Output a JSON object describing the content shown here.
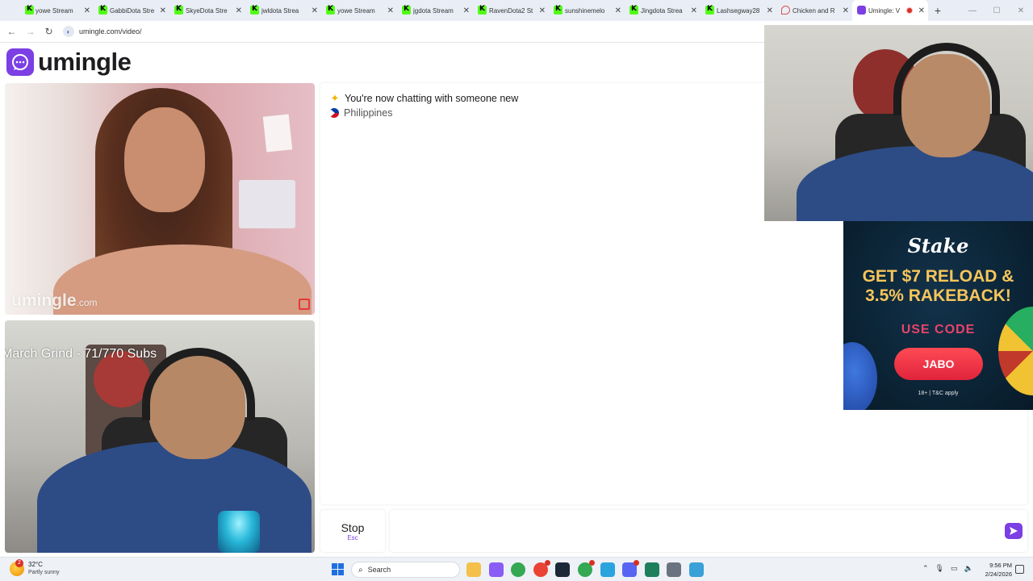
{
  "browser": {
    "tabs": [
      {
        "title": "yowe Stream",
        "icon": "kick-icon"
      },
      {
        "title": "GabbiDota Stre",
        "icon": "kick-icon"
      },
      {
        "title": "SkyeDota Stre",
        "icon": "kick-icon"
      },
      {
        "title": "jwldota Strea",
        "icon": "kick-icon"
      },
      {
        "title": "yowe Stream",
        "icon": "kick-icon"
      },
      {
        "title": "jgdota Stream",
        "icon": "kick-icon"
      },
      {
        "title": "RavenDota2 St",
        "icon": "kick-icon"
      },
      {
        "title": "sunshinemelo",
        "icon": "kick-icon"
      },
      {
        "title": "Jingdota Strea",
        "icon": "kick-icon"
      },
      {
        "title": "Lashsegway28",
        "icon": "kick-icon"
      },
      {
        "title": "Chicken and R",
        "icon": "pin-icon"
      },
      {
        "title": "Umingle: V",
        "icon": "umingle-icon",
        "active": true
      }
    ],
    "url": "umingle.com/video/"
  },
  "page": {
    "brand": "umingle",
    "brand_color": "#7b3fe4",
    "stranger_watermark": "umingle",
    "stranger_watermark_suffix": ".com",
    "stream_overlay_title": "March Grind - 71/770 Subs",
    "chat": {
      "status_line": "You're now chatting with someone new",
      "country": "Philippines"
    },
    "stop_button": {
      "label": "Stop",
      "shortcut": "Esc"
    },
    "message_input": {
      "placeholder": ""
    }
  },
  "ad": {
    "brand": "Stake",
    "headline_1": "GET $7 RELOAD &",
    "headline_2": "3.5% RAKEBACK!",
    "code_label": "USE CODE",
    "code": "JABO",
    "legal": "18+ | T&C apply"
  },
  "taskbar": {
    "weather_temp": "32°C",
    "weather_desc": "Partly sunny",
    "weather_badge": "2",
    "search_placeholder": "Search",
    "time": "9:56 PM",
    "date": "2/24/2026",
    "apps": [
      {
        "name": "file-explorer-icon",
        "color": "#f5c04a"
      },
      {
        "name": "copilot-icon",
        "color": "#8a5cf6"
      },
      {
        "name": "chrome-icon",
        "color": "#34a853"
      },
      {
        "name": "chrome-icon",
        "color": "#ea4335"
      },
      {
        "name": "steam-icon",
        "color": "#1b2838"
      },
      {
        "name": "chrome-icon",
        "color": "#34a853"
      },
      {
        "name": "telegram-icon",
        "color": "#2aa3df"
      },
      {
        "name": "discord-icon",
        "color": "#5865f2"
      },
      {
        "name": "streaming-app-icon",
        "color": "#1e7f5c"
      },
      {
        "name": "tool-icon",
        "color": "#6b7280"
      },
      {
        "name": "notepad-icon",
        "color": "#3aa0d8"
      }
    ]
  }
}
